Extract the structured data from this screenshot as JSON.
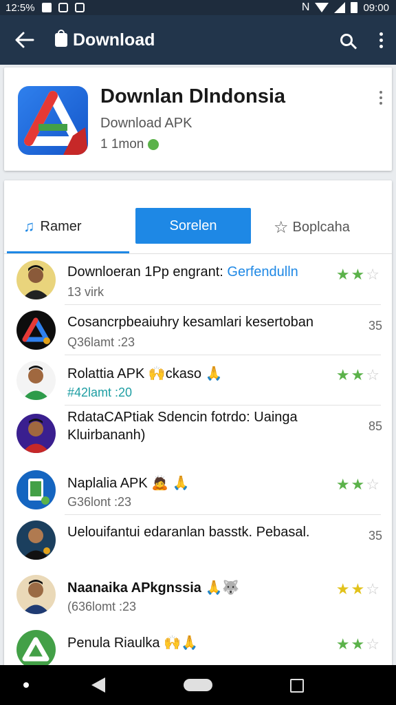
{
  "status_bar": {
    "time_left": "12:5%",
    "time_right": "09:00"
  },
  "app_bar": {
    "title": "Download"
  },
  "app": {
    "name": "Downlan Dlndonsia",
    "subtitle": "Download APK",
    "meta": "1 1mon"
  },
  "tabs": [
    {
      "label": "Ramer"
    },
    {
      "label": "Sorelen"
    },
    {
      "label": "Boplcaha"
    }
  ],
  "rows": [
    {
      "title": "Downloeran 1Pp engrant:",
      "title_accent": "Gerfendulln",
      "sub": "13 virk",
      "stars": [
        2,
        1
      ],
      "star_color": "green"
    },
    {
      "title": "Cosancrpbeaiuhry kesamlari kesertoban",
      "sub": "Q36lamt :23",
      "right": "35"
    },
    {
      "title": "Rolattia APK 🙌ckaso 🙏",
      "sub": "#42lamt :20",
      "sub_style": "teal",
      "stars": [
        2,
        1
      ],
      "star_color": "green"
    },
    {
      "title": "RdataCAPtiak Sdencin fotrdo: Uainga Kluirbananh)",
      "multi": true,
      "right": "85"
    },
    {
      "title": "Naplalia APK 🙇 🙏",
      "sub": "G36lont :23",
      "stars": [
        2,
        1
      ],
      "star_color": "green"
    },
    {
      "title": "Uelouifantui edaranlan basstk. Pebasal.",
      "right": "35"
    },
    {
      "title": "Naanaika APkgnssia 🙏🐺",
      "sub": "(636lomt :23",
      "stars": [
        2,
        1
      ],
      "star_color": "yellow"
    },
    {
      "title": "Penula Riaulka 🙌🙏",
      "sub": "",
      "stars": [
        2,
        1
      ],
      "star_color": "green"
    }
  ]
}
